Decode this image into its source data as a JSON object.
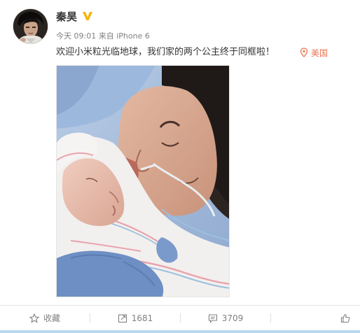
{
  "post": {
    "username": "秦昊",
    "verified_icon": "verified-v-badge-icon",
    "time": "今天 09:01",
    "source_prefix": "来自",
    "source": "iPhone 6",
    "text": "欢迎小米粒光临地球，我们家的两个公主终于同框啦！",
    "location": "美国",
    "location_icon": "location-pin-icon",
    "location_color": "#eb7350"
  },
  "actions": {
    "favorite_label": "收藏",
    "favorite_icon": "star-icon",
    "repost_count": "1681",
    "repost_icon": "repost-icon",
    "comment_count": "3709",
    "comment_icon": "comment-icon",
    "like_icon": "thumbs-up-icon"
  },
  "colors": {
    "text": "#333333",
    "muted": "#808080",
    "accent": "#eb7350",
    "verified": "#f5b400"
  }
}
